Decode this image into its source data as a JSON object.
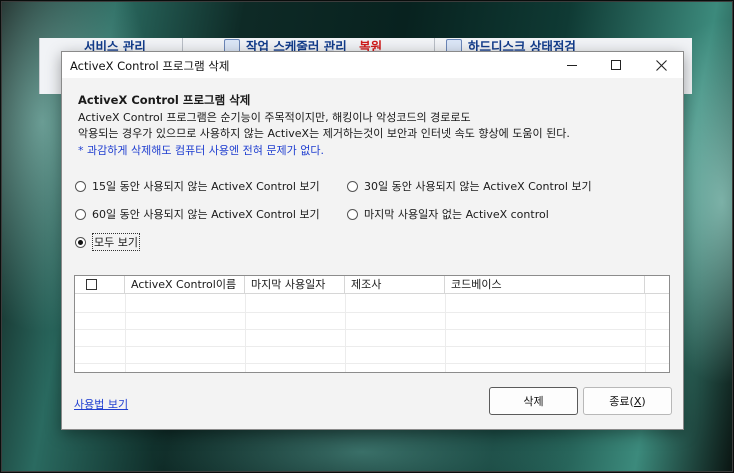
{
  "background_window": {
    "tabs": [
      {
        "label": "서비스 관리"
      },
      {
        "label": "작업 스케줄러 관리",
        "extra": "복원"
      },
      {
        "label": "하드디스크 상태점검"
      }
    ]
  },
  "dialog": {
    "title": "ActiveX Control 프로그램 삭제",
    "window_buttons": {
      "minimize": "minimize",
      "maximize": "maximize",
      "close": "close"
    },
    "heading": "ActiveX Control 프로그램 삭제",
    "description_line1": "ActiveX Control 프로그램은 순기능이 주목적이지만, 해킹이나 악성코드의 경로로도",
    "description_line2": "악용되는 경우가 있으므로 사용하지 않는 ActiveX는 제거하는것이 보안과 인터넷 속도 향상에 도움이 된다.",
    "note": "* 과감하게 삭제해도 컴퓨터 사용엔 전혀 문제가 없다.",
    "filters": [
      {
        "label": "15일 동안 사용되지 않는 ActiveX Control 보기",
        "selected": false
      },
      {
        "label": "30일 동안 사용되지 않는 ActiveX Control 보기",
        "selected": false
      },
      {
        "label": "60일 동안 사용되지 않는 ActiveX Control 보기",
        "selected": false
      },
      {
        "label": "마지막 사용일자 없는 ActiveX control",
        "selected": false
      },
      {
        "label": "모두 보기",
        "selected": true
      }
    ],
    "table": {
      "columns": [
        "ActiveX Control이름",
        "마지막 사용일자",
        "제조사",
        "코드베이스"
      ],
      "rows": []
    },
    "help_link": "사용법 보기",
    "delete_button": "삭제",
    "close_button": {
      "label": "종료(",
      "hotkey": "X",
      "suffix": ")"
    }
  },
  "colors": {
    "accent_link": "#1f3ed0",
    "note": "#1f3ed0",
    "bg_tab_text": "#123c8c",
    "bg_tab_red": "#d11a1a"
  }
}
